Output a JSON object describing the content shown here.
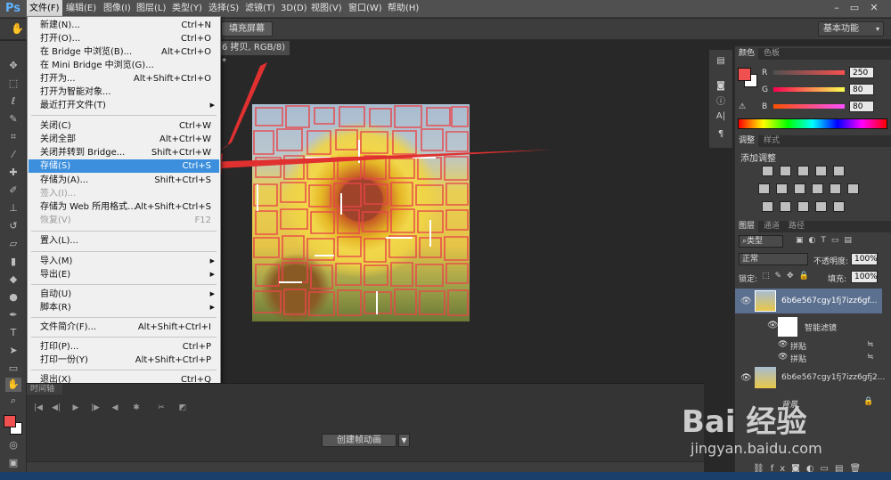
{
  "app": {
    "logo": "Ps"
  },
  "menubar": {
    "items": [
      "文件(F)",
      "编辑(E)",
      "图像(I)",
      "图层(L)",
      "类型(Y)",
      "选择(S)",
      "滤镜(T)",
      "3D(D)",
      "视图(V)",
      "窗口(W)",
      "帮助(H)"
    ]
  },
  "window_controls": {
    "minimize": "–",
    "restore": "▭",
    "close": "✕"
  },
  "options_bar": {
    "fill_screen_label": "填充屏幕",
    "workspace": "基本功能"
  },
  "document": {
    "tab_title": "6 拷贝, RGB/8) *"
  },
  "file_menu": {
    "items": [
      {
        "label": "新建(N)...",
        "shortcut": "Ctrl+N"
      },
      {
        "label": "打开(O)...",
        "shortcut": "Ctrl+O"
      },
      {
        "label": "在 Bridge 中浏览(B)...",
        "shortcut": "Alt+Ctrl+O"
      },
      {
        "label": "在 Mini Bridge 中浏览(G)...",
        "shortcut": ""
      },
      {
        "label": "打开为...",
        "shortcut": "Alt+Shift+Ctrl+O"
      },
      {
        "label": "打开为智能对象...",
        "shortcut": ""
      },
      {
        "label": "最近打开文件(T)",
        "shortcut": ""
      },
      {
        "label": "关闭(C)",
        "shortcut": "Ctrl+W"
      },
      {
        "label": "关闭全部",
        "shortcut": "Alt+Ctrl+W"
      },
      {
        "label": "关闭并转到 Bridge...",
        "shortcut": "Shift+Ctrl+W"
      },
      {
        "label": "存储(S)",
        "shortcut": "Ctrl+S"
      },
      {
        "label": "存储为(A)...",
        "shortcut": "Shift+Ctrl+S"
      },
      {
        "label": "签入(I)...",
        "shortcut": ""
      },
      {
        "label": "存储为 Web 所用格式...",
        "shortcut": "Alt+Shift+Ctrl+S"
      },
      {
        "label": "恢复(V)",
        "shortcut": "F12"
      },
      {
        "label": "置入(L)...",
        "shortcut": ""
      },
      {
        "label": "导入(M)",
        "shortcut": ""
      },
      {
        "label": "导出(E)",
        "shortcut": ""
      },
      {
        "label": "自动(U)",
        "shortcut": ""
      },
      {
        "label": "脚本(R)",
        "shortcut": ""
      },
      {
        "label": "文件简介(F)...",
        "shortcut": "Alt+Shift+Ctrl+I"
      },
      {
        "label": "打印(P)...",
        "shortcut": "Ctrl+P"
      },
      {
        "label": "打印一份(Y)",
        "shortcut": "Alt+Shift+Ctrl+P"
      },
      {
        "label": "退出(X)",
        "shortcut": "Ctrl+Q"
      }
    ]
  },
  "timeline": {
    "tab": "时间轴",
    "create_button": "创建帧动画"
  },
  "color_panel": {
    "tabs": [
      "颜色",
      "色板"
    ],
    "r_label": "R",
    "g_label": "G",
    "b_label": "B",
    "r": "250",
    "g": "80",
    "b": "80",
    "foreground": "#f05050"
  },
  "adjust_panel": {
    "tabs": [
      "调整",
      "样式"
    ],
    "title": "添加调整"
  },
  "layers_panel": {
    "tabs": [
      "图层",
      "通道",
      "路径"
    ],
    "kind_filter": "类型",
    "blend_mode": "正常",
    "opacity_label": "不透明度:",
    "opacity": "100%",
    "lock_label": "锁定:",
    "fill_label": "填充:",
    "fill": "100%",
    "layers": [
      {
        "name": "6b6e567cgy1fj7izz6gf..."
      },
      {
        "name": "智能滤镜"
      },
      {
        "name": "拼贴"
      },
      {
        "name": "拼贴"
      },
      {
        "name": "6b6e567cgy1fj7izz6gfj2..."
      },
      {
        "name": "背景"
      }
    ],
    "footer_icons": [
      "link-icon",
      "fx-icon",
      "mask-icon",
      "adjustment-icon",
      "group-icon",
      "new-layer-icon",
      "trash-icon"
    ]
  },
  "watermark": {
    "logo": "Bai 经验",
    "url": "jingyan.baidu.com"
  }
}
